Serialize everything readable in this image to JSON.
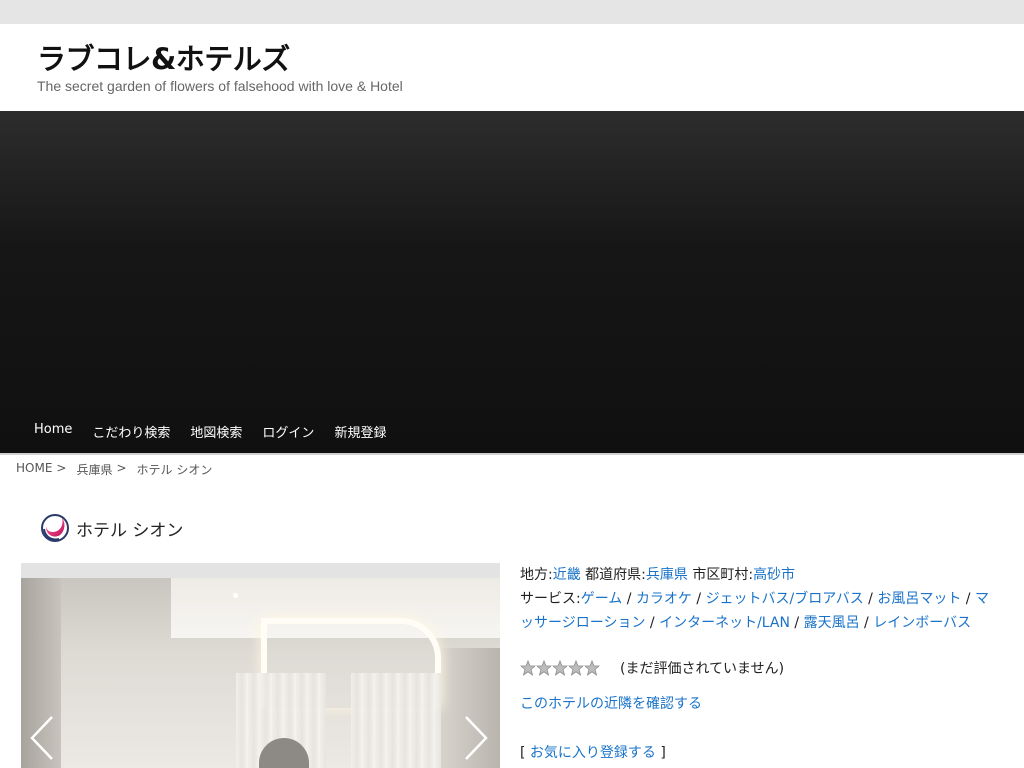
{
  "site": {
    "title": "ラブコレ&ホテルズ",
    "tagline": "The secret garden of flowers of falsehood with love & Hotel"
  },
  "nav": {
    "items": [
      "Home",
      "こだわり検索",
      "地図検索",
      "ログイン",
      "新規登録"
    ]
  },
  "breadcrumb": {
    "items": [
      "HOME",
      "兵庫県",
      "ホテル シオン"
    ],
    "separator": ">"
  },
  "hotel": {
    "name": "ホテル シオン",
    "logo_icon": "brand-swirl-icon"
  },
  "info": {
    "region_label": "地方:",
    "region_value": "近畿",
    "prefecture_label": "都道府県:",
    "prefecture_value": "兵庫県",
    "city_label": "市区町村:",
    "city_value": "高砂市",
    "services_label": "サービス:",
    "services": [
      "ゲーム",
      "カラオケ",
      "ジェットバス/ブロアバス",
      "お風呂マット",
      "マッサージローション",
      "インターネット/LAN",
      "露天風呂",
      "レインボーバス"
    ],
    "service_separator": " / "
  },
  "rating": {
    "stars_filled": 0,
    "stars_total": 5,
    "text": "(まだ評価されていません)"
  },
  "links": {
    "nearby": "このホテルの近隣を確認する",
    "favorite_open": "[ ",
    "favorite": "お気に入り登録する",
    "favorite_close": " ]"
  },
  "slider": {
    "prev_icon": "chevron-left-icon",
    "next_icon": "chevron-right-icon"
  },
  "colors": {
    "link": "#1a73c9",
    "hero_top": "#2d2d2d",
    "hero_bottom": "#101010",
    "topbar": "#e5e5e5"
  }
}
